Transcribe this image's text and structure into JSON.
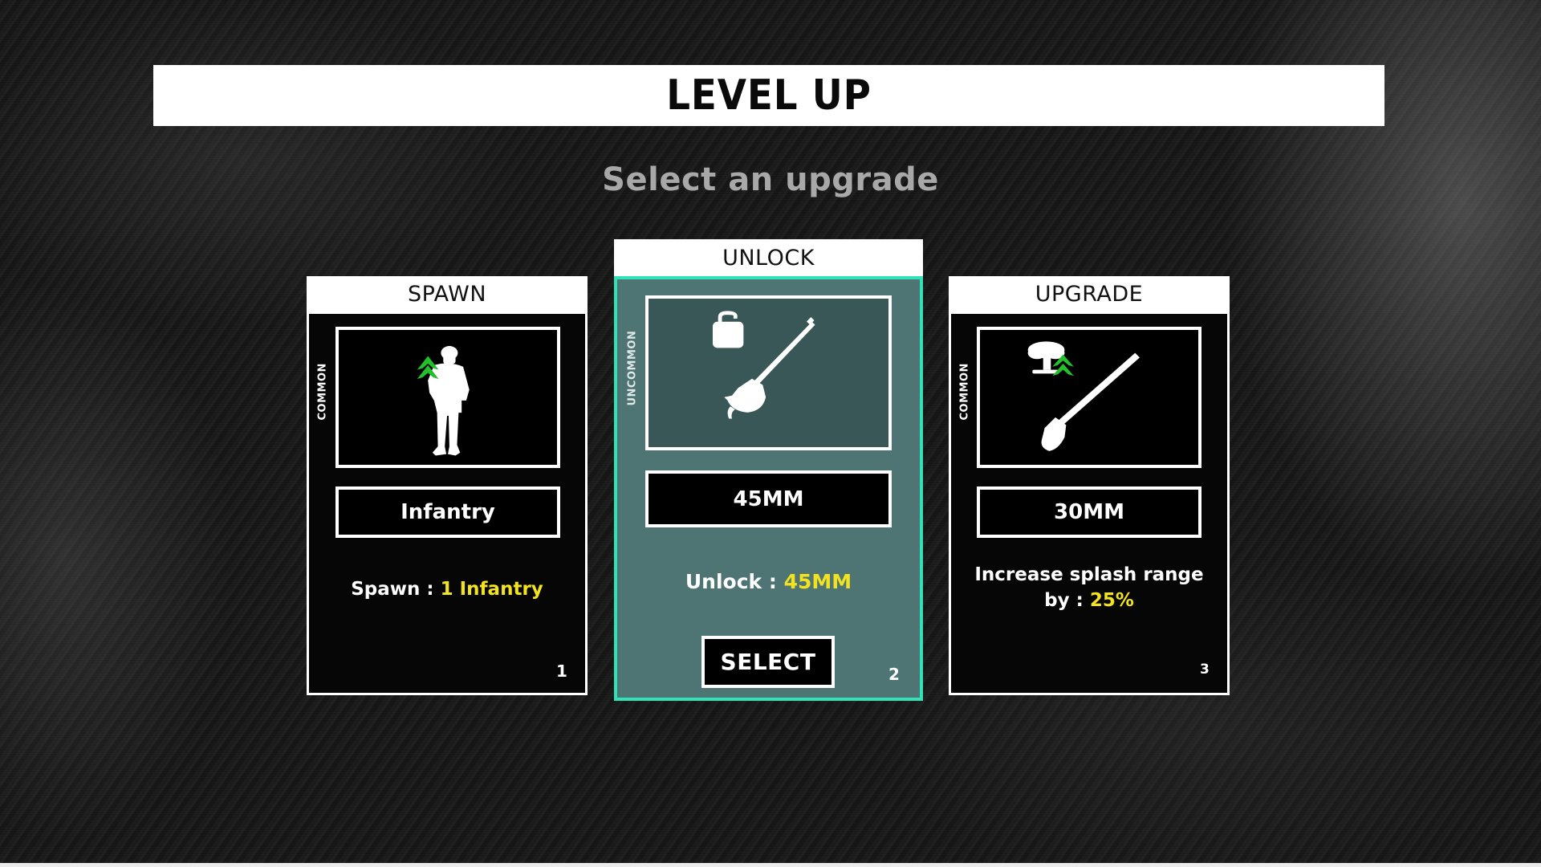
{
  "screen": {
    "title": "LEVEL UP",
    "subtitle": "Select an upgrade"
  },
  "colors": {
    "highlight_yellow": "#f2e21f",
    "selected_border": "#2fe3b6",
    "selected_background": "#4f7474",
    "upgrade_arrow_green": "#22c02a"
  },
  "cards": [
    {
      "type": "SPAWN",
      "rarity": "COMMON",
      "icon": "infantry-soldier-icon",
      "badge_icon": "double-chevron-up-icon",
      "name": "Infantry",
      "description_prefix": "Spawn :",
      "description_value": "1 Infantry",
      "number": "1",
      "selected": false
    },
    {
      "type": "UNLOCK",
      "rarity": "UNCOMMON",
      "icon": "45mm-gun-icon",
      "badge_icon": "padlock-open-icon",
      "name": "45MM",
      "description_prefix": "Unlock :",
      "description_value": "45MM",
      "number": "2",
      "selected": true,
      "select_label": "SELECT"
    },
    {
      "type": "UPGRADE",
      "rarity": "COMMON",
      "icon": "30mm-gun-icon",
      "badge_icon": "explosion-upgrade-icon",
      "name": "30MM",
      "description_prefix_line1": "Increase splash range",
      "description_prefix_line2": "by :",
      "description_value": "25%",
      "number": "3",
      "selected": false
    }
  ]
}
